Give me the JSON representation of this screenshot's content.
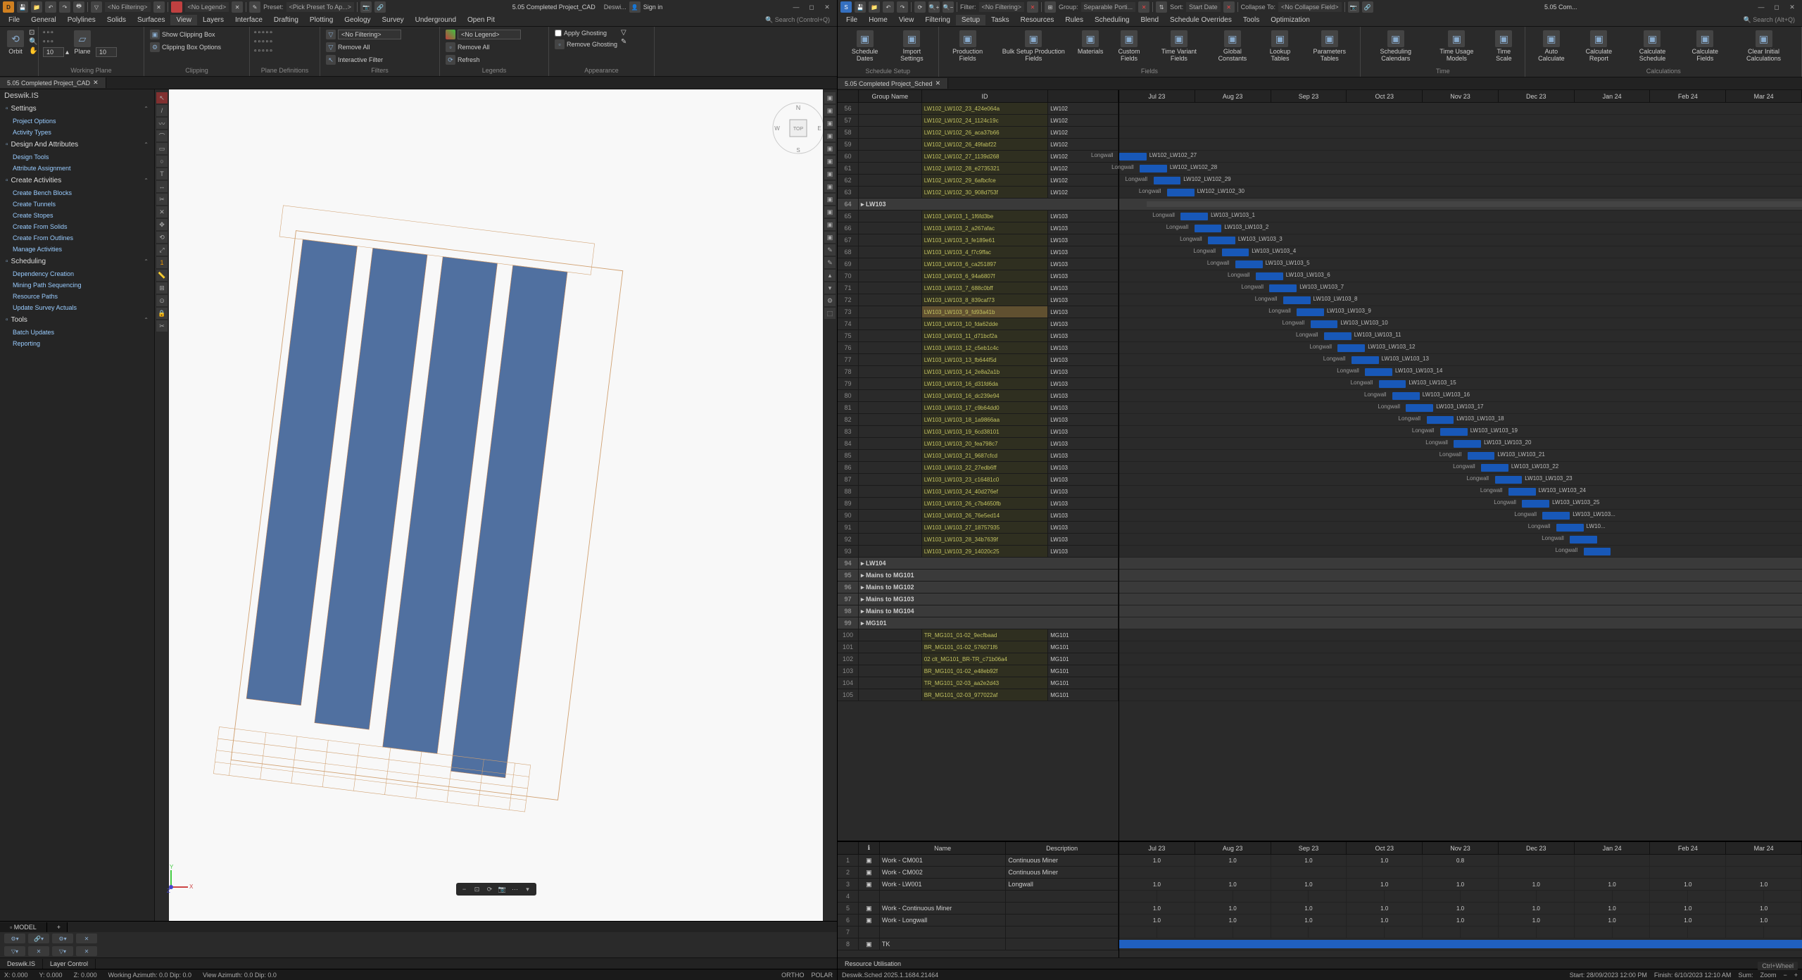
{
  "left": {
    "titlebar": {
      "filters": [
        "<No Filtering>",
        "<No Legend>"
      ],
      "preset_label": "Preset:",
      "preset_value": "<Pick Preset To Ap...>",
      "file_label": "5.05 Completed Project_CAD",
      "product": "Deswi...",
      "signin": "Sign in"
    },
    "menus": [
      "File",
      "General",
      "Polylines",
      "Solids",
      "Surfaces",
      "View",
      "Layers",
      "Interface",
      "Drafting",
      "Plotting",
      "Geology",
      "Survey",
      "Underground",
      "Open Pit"
    ],
    "menu_active": 5,
    "menu_search": "Search (Control+Q)",
    "ribbon": {
      "orbit": "Orbit",
      "plane": "Plane",
      "working_plane": "Working Plane",
      "clipbox_show": "Show Clipping Box",
      "clipbox_opts": "Clipping Box Options",
      "clipping": "Clipping",
      "plane_defs": "Plane Definitions",
      "legend": "Legends",
      "filter_field": "<No Filtering>",
      "remove_all": "Remove All",
      "interactive_filter": "Interactive Filter",
      "filters": "Filters",
      "legend_field": "<No Legend>",
      "remove_all2": "Remove All",
      "refresh": "Refresh",
      "ghost_apply": "Apply Ghosting",
      "ghost_remove": "Remove Ghosting",
      "appearance": "Appearance",
      "box_10a": "10",
      "box_10b": "10"
    },
    "tab": "5.05 Completed Project_CAD",
    "panel": {
      "title": "Deswik.IS",
      "sections": [
        {
          "title": "Settings",
          "items": [
            "Project Options",
            "Activity Types"
          ]
        },
        {
          "title": "Design And Attributes",
          "items": [
            "Design Tools",
            "Attribute Assignment"
          ]
        },
        {
          "title": "Create Activities",
          "items": [
            "Create Bench Blocks",
            "Create Tunnels",
            "Create Stopes",
            "Create From Solids",
            "Create From Outlines",
            "Manage Activities"
          ]
        },
        {
          "title": "Scheduling",
          "items": [
            "Dependency Creation",
            "Mining Path Sequencing",
            "Resource Paths",
            "Update Survey Actuals"
          ]
        },
        {
          "title": "Tools",
          "items": [
            "Batch Updates",
            "Reporting"
          ]
        }
      ]
    },
    "model_tab": "MODEL",
    "footer_tabs": [
      "Deswik.IS",
      "Layer Control"
    ],
    "status": {
      "x": "X: 0.000",
      "y": "Y: 0.000",
      "z": "Z: 0.000",
      "wa": "Working Azimuth: 0.0 Dip: 0.0",
      "va": "View Azimuth: 0.0 Dip: 0.0",
      "ortho": "ORTHO",
      "polar": "POLAR"
    },
    "compass": [
      "N",
      "E",
      "S",
      "W",
      "TOP"
    ]
  },
  "right": {
    "titlebar": {
      "filter_label": "Filter:",
      "filter_value": "<No Filtering>",
      "group_label": "Group:",
      "group_value": "Separable Porti...",
      "sort_label": "Sort:",
      "sort_value": "Start Date",
      "collapse_label": "Collapse To:",
      "collapse_value": "<No Collapse Field>",
      "file_label": "5.05 Com..."
    },
    "menus": [
      "File",
      "Home",
      "View",
      "Filtering",
      "Setup",
      "Tasks",
      "Resources",
      "Rules",
      "Scheduling",
      "Blend",
      "Schedule Overrides",
      "Tools",
      "Optimization"
    ],
    "menu_active": 4,
    "menu_search": "Search (Alt+Q)",
    "ribbon": {
      "buttons": [
        "Schedule Dates",
        "Import Settings",
        "Production Fields",
        "Bulk Setup Production Fields",
        "Materials",
        "Custom Fields",
        "Time Variant Fields",
        "Global Constants",
        "Lookup Tables",
        "Parameters Tables",
        "Scheduling Calendars",
        "Time Usage Models",
        "Time Scale",
        "Auto Calculate",
        "Calculate Report",
        "Calculate Schedule",
        "Calculate Fields",
        "Clear Initial Calculations"
      ],
      "groups": [
        "Schedule Setup",
        "Fields",
        "Time",
        "Calculations"
      ]
    },
    "tab": "5.05 Completed Project_Sched",
    "gantt": {
      "headers": [
        "Group Name",
        "ID",
        ""
      ],
      "months": [
        "Jul 23",
        "Aug 23",
        "Sep 23",
        "Oct 23",
        "Nov 23",
        "Dec 23",
        "Jan 24",
        "Feb 24",
        "Mar 24"
      ],
      "rows": [
        {
          "n": 56,
          "id": "LW102_LW102_23_424e064a",
          "act": "LW102"
        },
        {
          "n": 57,
          "id": "LW102_LW102_24_1124c19c",
          "act": "LW102"
        },
        {
          "n": 58,
          "id": "LW102_LW102_26_aca37b66",
          "act": "LW102"
        },
        {
          "n": 59,
          "id": "LW102_LW102_26_49fabf22",
          "act": "LW102"
        },
        {
          "n": 60,
          "id": "LW102_LW102_27_1139d268",
          "act": "LW102",
          "role": "Longwall",
          "label": "LW102_LW102_27",
          "bs": 0,
          "be": 4
        },
        {
          "n": 61,
          "id": "LW102_LW102_28_e2735321",
          "act": "LW102",
          "role": "Longwall",
          "label": "LW102_LW102_28",
          "bs": 3,
          "be": 7
        },
        {
          "n": 62,
          "id": "LW102_LW102_29_6afbcfce",
          "act": "LW102",
          "role": "Longwall",
          "label": "LW102_LW102_29",
          "bs": 5,
          "be": 9
        },
        {
          "n": 63,
          "id": "LW102_LW102_30_908d753f",
          "act": "LW102",
          "role": "Longwall",
          "label": "LW102_LW102_30",
          "bs": 7,
          "be": 11
        },
        {
          "n": 64,
          "group": "LW103",
          "gbs": 4,
          "gbe": 100
        },
        {
          "n": 65,
          "id": "LW103_LW103_1_1f6fd3be",
          "act": "LW103",
          "role": "Longwall",
          "label": "LW103_LW103_1",
          "bs": 9,
          "be": 13
        },
        {
          "n": 66,
          "id": "LW103_LW103_2_a267afac",
          "act": "LW103",
          "role": "Longwall",
          "label": "LW103_LW103_2",
          "bs": 11,
          "be": 15
        },
        {
          "n": 67,
          "id": "LW103_LW103_3_fe189e61",
          "act": "LW103",
          "role": "Longwall",
          "label": "LW103_LW103_3",
          "bs": 13,
          "be": 17
        },
        {
          "n": 68,
          "id": "LW103_LW103_4_f7c9ffac",
          "act": "LW103",
          "role": "Longwall",
          "label": "LW103_LW103_4",
          "bs": 15,
          "be": 19
        },
        {
          "n": 69,
          "id": "LW103_LW103_6_ca251897",
          "act": "LW103",
          "role": "Longwall",
          "label": "LW103_LW103_5",
          "bs": 17,
          "be": 21
        },
        {
          "n": 70,
          "id": "LW103_LW103_6_94a6807f",
          "act": "LW103",
          "role": "Longwall",
          "label": "LW103_LW103_6",
          "bs": 20,
          "be": 24
        },
        {
          "n": 71,
          "id": "LW103_LW103_7_688c0bff",
          "act": "LW103",
          "role": "Longwall",
          "label": "LW103_LW103_7",
          "bs": 22,
          "be": 26
        },
        {
          "n": 72,
          "id": "LW103_LW103_8_839caf73",
          "act": "LW103",
          "role": "Longwall",
          "label": "LW103_LW103_8",
          "bs": 24,
          "be": 28
        },
        {
          "n": 73,
          "id": "LW103_LW103_9_fd93a41b",
          "act": "LW103",
          "role": "Longwall",
          "label": "LW103_LW103_9",
          "bs": 26,
          "be": 30,
          "hl": true
        },
        {
          "n": 74,
          "id": "LW103_LW103_10_fda62dde",
          "act": "LW103",
          "role": "Longwall",
          "label": "LW103_LW103_10",
          "bs": 28,
          "be": 32
        },
        {
          "n": 75,
          "id": "LW103_LW103_11_d71bcf2a",
          "act": "LW103",
          "role": "Longwall",
          "label": "LW103_LW103_11",
          "bs": 30,
          "be": 34
        },
        {
          "n": 76,
          "id": "LW103_LW103_12_c5eb1c4c",
          "act": "LW103",
          "role": "Longwall",
          "label": "LW103_LW103_12",
          "bs": 32,
          "be": 36
        },
        {
          "n": 77,
          "id": "LW103_LW103_13_fb644f5d",
          "act": "LW103",
          "role": "Longwall",
          "label": "LW103_LW103_13",
          "bs": 34,
          "be": 38
        },
        {
          "n": 78,
          "id": "LW103_LW103_14_2e8a2a1b",
          "act": "LW103",
          "role": "Longwall",
          "label": "LW103_LW103_14",
          "bs": 36,
          "be": 40
        },
        {
          "n": 79,
          "id": "LW103_LW103_16_d31fd6da",
          "act": "LW103",
          "role": "Longwall",
          "label": "LW103_LW103_15",
          "bs": 38,
          "be": 42
        },
        {
          "n": 80,
          "id": "LW103_LW103_16_dc239e94",
          "act": "LW103",
          "role": "Longwall",
          "label": "LW103_LW103_16",
          "bs": 40,
          "be": 44
        },
        {
          "n": 81,
          "id": "LW103_LW103_17_c9b64dd0",
          "act": "LW103",
          "role": "Longwall",
          "label": "LW103_LW103_17",
          "bs": 42,
          "be": 46
        },
        {
          "n": 82,
          "id": "LW103_LW103_18_1a9866aa",
          "act": "LW103",
          "role": "Longwall",
          "label": "LW103_LW103_18",
          "bs": 45,
          "be": 49
        },
        {
          "n": 83,
          "id": "LW103_LW103_19_6cd38101",
          "act": "LW103",
          "role": "Longwall",
          "label": "LW103_LW103_19",
          "bs": 47,
          "be": 51
        },
        {
          "n": 84,
          "id": "LW103_LW103_20_fea798c7",
          "act": "LW103",
          "role": "Longwall",
          "label": "LW103_LW103_20",
          "bs": 49,
          "be": 53
        },
        {
          "n": 85,
          "id": "LW103_LW103_21_9687cfcd",
          "act": "LW103",
          "role": "Longwall",
          "label": "LW103_LW103_21",
          "bs": 51,
          "be": 55
        },
        {
          "n": 86,
          "id": "LW103_LW103_22_27edb6ff",
          "act": "LW103",
          "role": "Longwall",
          "label": "LW103_LW103_22",
          "bs": 53,
          "be": 57
        },
        {
          "n": 87,
          "id": "LW103_LW103_23_c16481c0",
          "act": "LW103",
          "role": "Longwall",
          "label": "LW103_LW103_23",
          "bs": 55,
          "be": 59
        },
        {
          "n": 88,
          "id": "LW103_LW103_24_40d276ef",
          "act": "LW103",
          "role": "Longwall",
          "label": "LW103_LW103_24",
          "bs": 57,
          "be": 61
        },
        {
          "n": 89,
          "id": "LW103_LW103_26_c7b4650fb",
          "act": "LW103",
          "role": "Longwall",
          "label": "LW103_LW103_25",
          "bs": 59,
          "be": 63
        },
        {
          "n": 90,
          "id": "LW103_LW103_26_76e5ed14",
          "act": "LW103",
          "role": "Longwall",
          "label": "LW103_LW103...",
          "bs": 62,
          "be": 66
        },
        {
          "n": 91,
          "id": "LW103_LW103_27_18757935",
          "act": "LW103",
          "role": "Longwall",
          "label": "LW10...",
          "bs": 64,
          "be": 68
        },
        {
          "n": 92,
          "id": "LW103_LW103_28_34b7639f",
          "act": "LW103",
          "role": "Longwall",
          "label": "",
          "bs": 66,
          "be": 70
        },
        {
          "n": 93,
          "id": "LW103_LW103_29_14020c25",
          "act": "LW103",
          "role": "Longwall",
          "label": "",
          "bs": 68,
          "be": 72
        },
        {
          "n": 94,
          "group": "LW104"
        },
        {
          "n": 95,
          "group": "Mains to MG101"
        },
        {
          "n": 96,
          "group": "Mains to MG102"
        },
        {
          "n": 97,
          "group": "Mains to MG103"
        },
        {
          "n": 98,
          "group": "Mains to MG104"
        },
        {
          "n": 99,
          "group": "MG101"
        },
        {
          "n": 100,
          "id": "TR_MG101_01-02_9ecfbaad",
          "act": "MG101"
        },
        {
          "n": 101,
          "id": "BR_MG101_01-02_576071f6",
          "act": "MG101"
        },
        {
          "n": 102,
          "id": "02 clt_MG101_BR-TR_c71b06a4",
          "act": "MG101"
        },
        {
          "n": 103,
          "id": "BR_MG101_01-02_e48eb92f",
          "act": "MG101"
        },
        {
          "n": 104,
          "id": "TR_MG101_02-03_aa2e2d43",
          "act": "MG101"
        },
        {
          "n": 105,
          "id": "BR_MG101_02-03_977022af",
          "act": "MG101"
        }
      ]
    },
    "resource": {
      "headers": [
        "",
        "",
        "Name",
        "Description"
      ],
      "months": [
        "Jul 23",
        "Aug 23",
        "Sep 23",
        "Oct 23",
        "Nov 23",
        "Dec 23",
        "Jan 24",
        "Feb 24",
        "Mar 24"
      ],
      "rows": [
        {
          "n": 1,
          "name": "Work - CM001",
          "desc": "Continuous Miner",
          "vals": [
            "1.0",
            "1.0",
            "1.0",
            "1.0",
            "0.8",
            "",
            "",
            "",
            ""
          ]
        },
        {
          "n": 2,
          "name": "Work - CM002",
          "desc": "Continuous Miner",
          "vals": [
            "",
            "",
            "",
            "",
            "",
            "",
            "",
            "",
            ""
          ]
        },
        {
          "n": 3,
          "name": "Work - LW001",
          "desc": "Longwall",
          "vals": [
            "1.0",
            "1.0",
            "1.0",
            "1.0",
            "1.0",
            "1.0",
            "1.0",
            "1.0",
            "1.0"
          ]
        },
        {
          "n": 4,
          "name": "",
          "desc": "",
          "vals": []
        },
        {
          "n": 5,
          "name": "Work - Continuous Miner",
          "desc": "",
          "vals": [
            "1.0",
            "1.0",
            "1.0",
            "1.0",
            "1.0",
            "1.0",
            "1.0",
            "1.0",
            "1.0"
          ]
        },
        {
          "n": 6,
          "name": "Work - Longwall",
          "desc": "",
          "vals": [
            "1.0",
            "1.0",
            "1.0",
            "1.0",
            "1.0",
            "1.0",
            "1.0",
            "1.0",
            "1.0"
          ]
        },
        {
          "n": 7,
          "name": "",
          "desc": "",
          "vals": []
        },
        {
          "n": 8,
          "name": "TK",
          "desc": "",
          "bar": true
        }
      ],
      "tab": "Resource Utilisation"
    },
    "status": {
      "app": "Deswik.Sched 2025.1.1684.21464",
      "start": "Start: 28/09/2023 12:00 PM",
      "finish": "Finish: 6/10/2023 12:10 AM",
      "sum": "Sum:",
      "zoom": "Zoom",
      "ctrlwheel": "Ctrl+Wheel"
    }
  }
}
